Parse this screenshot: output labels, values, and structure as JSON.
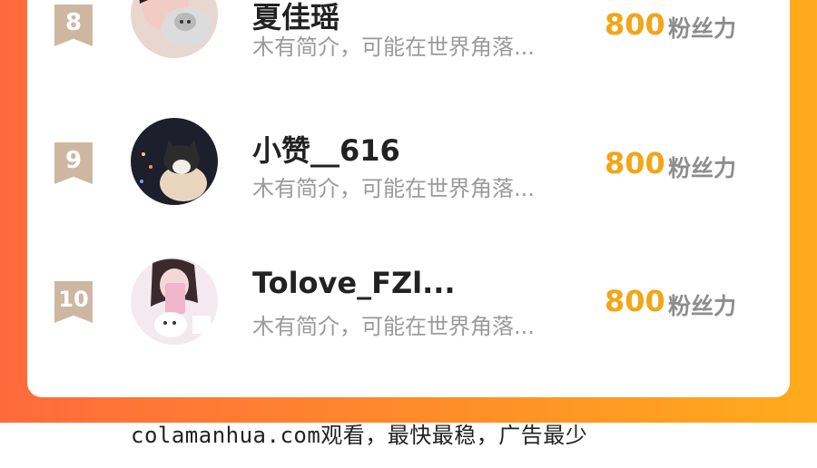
{
  "list": {
    "items": [
      {
        "rank": "8",
        "name": "夏佳瑶",
        "bio": "木有简介，可能在世界角落...",
        "score": "800",
        "unit": "粉丝力"
      },
      {
        "rank": "9",
        "name": "小赞__616",
        "bio": "木有简介，可能在世界角落...",
        "score": "800",
        "unit": "粉丝力"
      },
      {
        "rank": "10",
        "name": "Tolove_FZl...",
        "bio": "木有简介，可能在世界角落...",
        "score": "800",
        "unit": "粉丝力"
      }
    ]
  },
  "footer": {
    "text": "colamanhua.com观看，最快最稳，广告最少"
  },
  "colors": {
    "accent": "#f2a516",
    "rank_badge": "#ceb7a0",
    "gradient_start": "#ff6a3d",
    "gradient_end": "#ffab1c"
  },
  "icons": [
    "rank-badge-icon",
    "avatar"
  ]
}
